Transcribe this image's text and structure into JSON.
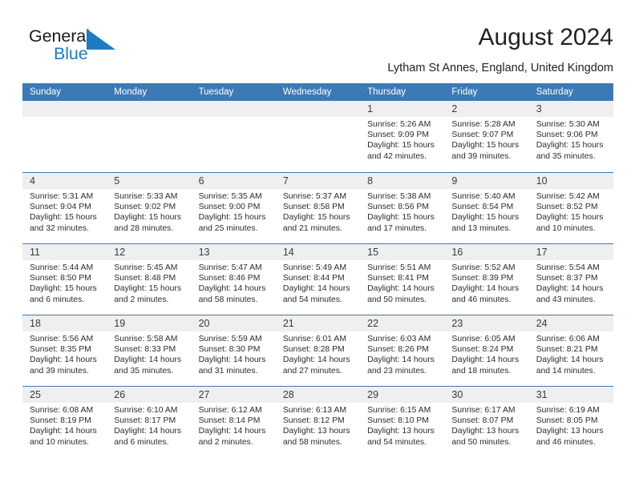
{
  "brand": {
    "name_part1": "General",
    "name_part2": "Blue",
    "logo_icon": "blue-triangle-flag-icon",
    "color_primary": "#1f7ac4",
    "color_text": "#1b1b1b"
  },
  "header": {
    "title": "August 2024",
    "subtitle": "Lytham St Annes, England, United Kingdom"
  },
  "theme": {
    "header_blue": "#3c7ab5",
    "date_strip_gray": "#efefef",
    "body_text": "#2c2c2c"
  },
  "calendar": {
    "weekdays": [
      "Sunday",
      "Monday",
      "Tuesday",
      "Wednesday",
      "Thursday",
      "Friday",
      "Saturday"
    ],
    "weeks": [
      [
        {
          "day": "",
          "empty": true
        },
        {
          "day": "",
          "empty": true
        },
        {
          "day": "",
          "empty": true
        },
        {
          "day": "",
          "empty": true
        },
        {
          "day": "1",
          "sunrise": "Sunrise: 5:26 AM",
          "sunset": "Sunset: 9:09 PM",
          "daylight1": "Daylight: 15 hours",
          "daylight2": "and 42 minutes."
        },
        {
          "day": "2",
          "sunrise": "Sunrise: 5:28 AM",
          "sunset": "Sunset: 9:07 PM",
          "daylight1": "Daylight: 15 hours",
          "daylight2": "and 39 minutes."
        },
        {
          "day": "3",
          "sunrise": "Sunrise: 5:30 AM",
          "sunset": "Sunset: 9:06 PM",
          "daylight1": "Daylight: 15 hours",
          "daylight2": "and 35 minutes."
        }
      ],
      [
        {
          "day": "4",
          "sunrise": "Sunrise: 5:31 AM",
          "sunset": "Sunset: 9:04 PM",
          "daylight1": "Daylight: 15 hours",
          "daylight2": "and 32 minutes."
        },
        {
          "day": "5",
          "sunrise": "Sunrise: 5:33 AM",
          "sunset": "Sunset: 9:02 PM",
          "daylight1": "Daylight: 15 hours",
          "daylight2": "and 28 minutes."
        },
        {
          "day": "6",
          "sunrise": "Sunrise: 5:35 AM",
          "sunset": "Sunset: 9:00 PM",
          "daylight1": "Daylight: 15 hours",
          "daylight2": "and 25 minutes."
        },
        {
          "day": "7",
          "sunrise": "Sunrise: 5:37 AM",
          "sunset": "Sunset: 8:58 PM",
          "daylight1": "Daylight: 15 hours",
          "daylight2": "and 21 minutes."
        },
        {
          "day": "8",
          "sunrise": "Sunrise: 5:38 AM",
          "sunset": "Sunset: 8:56 PM",
          "daylight1": "Daylight: 15 hours",
          "daylight2": "and 17 minutes."
        },
        {
          "day": "9",
          "sunrise": "Sunrise: 5:40 AM",
          "sunset": "Sunset: 8:54 PM",
          "daylight1": "Daylight: 15 hours",
          "daylight2": "and 13 minutes."
        },
        {
          "day": "10",
          "sunrise": "Sunrise: 5:42 AM",
          "sunset": "Sunset: 8:52 PM",
          "daylight1": "Daylight: 15 hours",
          "daylight2": "and 10 minutes."
        }
      ],
      [
        {
          "day": "11",
          "sunrise": "Sunrise: 5:44 AM",
          "sunset": "Sunset: 8:50 PM",
          "daylight1": "Daylight: 15 hours",
          "daylight2": "and 6 minutes."
        },
        {
          "day": "12",
          "sunrise": "Sunrise: 5:45 AM",
          "sunset": "Sunset: 8:48 PM",
          "daylight1": "Daylight: 15 hours",
          "daylight2": "and 2 minutes."
        },
        {
          "day": "13",
          "sunrise": "Sunrise: 5:47 AM",
          "sunset": "Sunset: 8:46 PM",
          "daylight1": "Daylight: 14 hours",
          "daylight2": "and 58 minutes."
        },
        {
          "day": "14",
          "sunrise": "Sunrise: 5:49 AM",
          "sunset": "Sunset: 8:44 PM",
          "daylight1": "Daylight: 14 hours",
          "daylight2": "and 54 minutes."
        },
        {
          "day": "15",
          "sunrise": "Sunrise: 5:51 AM",
          "sunset": "Sunset: 8:41 PM",
          "daylight1": "Daylight: 14 hours",
          "daylight2": "and 50 minutes."
        },
        {
          "day": "16",
          "sunrise": "Sunrise: 5:52 AM",
          "sunset": "Sunset: 8:39 PM",
          "daylight1": "Daylight: 14 hours",
          "daylight2": "and 46 minutes."
        },
        {
          "day": "17",
          "sunrise": "Sunrise: 5:54 AM",
          "sunset": "Sunset: 8:37 PM",
          "daylight1": "Daylight: 14 hours",
          "daylight2": "and 43 minutes."
        }
      ],
      [
        {
          "day": "18",
          "sunrise": "Sunrise: 5:56 AM",
          "sunset": "Sunset: 8:35 PM",
          "daylight1": "Daylight: 14 hours",
          "daylight2": "and 39 minutes."
        },
        {
          "day": "19",
          "sunrise": "Sunrise: 5:58 AM",
          "sunset": "Sunset: 8:33 PM",
          "daylight1": "Daylight: 14 hours",
          "daylight2": "and 35 minutes."
        },
        {
          "day": "20",
          "sunrise": "Sunrise: 5:59 AM",
          "sunset": "Sunset: 8:30 PM",
          "daylight1": "Daylight: 14 hours",
          "daylight2": "and 31 minutes."
        },
        {
          "day": "21",
          "sunrise": "Sunrise: 6:01 AM",
          "sunset": "Sunset: 8:28 PM",
          "daylight1": "Daylight: 14 hours",
          "daylight2": "and 27 minutes."
        },
        {
          "day": "22",
          "sunrise": "Sunrise: 6:03 AM",
          "sunset": "Sunset: 8:26 PM",
          "daylight1": "Daylight: 14 hours",
          "daylight2": "and 23 minutes."
        },
        {
          "day": "23",
          "sunrise": "Sunrise: 6:05 AM",
          "sunset": "Sunset: 8:24 PM",
          "daylight1": "Daylight: 14 hours",
          "daylight2": "and 18 minutes."
        },
        {
          "day": "24",
          "sunrise": "Sunrise: 6:06 AM",
          "sunset": "Sunset: 8:21 PM",
          "daylight1": "Daylight: 14 hours",
          "daylight2": "and 14 minutes."
        }
      ],
      [
        {
          "day": "25",
          "sunrise": "Sunrise: 6:08 AM",
          "sunset": "Sunset: 8:19 PM",
          "daylight1": "Daylight: 14 hours",
          "daylight2": "and 10 minutes."
        },
        {
          "day": "26",
          "sunrise": "Sunrise: 6:10 AM",
          "sunset": "Sunset: 8:17 PM",
          "daylight1": "Daylight: 14 hours",
          "daylight2": "and 6 minutes."
        },
        {
          "day": "27",
          "sunrise": "Sunrise: 6:12 AM",
          "sunset": "Sunset: 8:14 PM",
          "daylight1": "Daylight: 14 hours",
          "daylight2": "and 2 minutes."
        },
        {
          "day": "28",
          "sunrise": "Sunrise: 6:13 AM",
          "sunset": "Sunset: 8:12 PM",
          "daylight1": "Daylight: 13 hours",
          "daylight2": "and 58 minutes."
        },
        {
          "day": "29",
          "sunrise": "Sunrise: 6:15 AM",
          "sunset": "Sunset: 8:10 PM",
          "daylight1": "Daylight: 13 hours",
          "daylight2": "and 54 minutes."
        },
        {
          "day": "30",
          "sunrise": "Sunrise: 6:17 AM",
          "sunset": "Sunset: 8:07 PM",
          "daylight1": "Daylight: 13 hours",
          "daylight2": "and 50 minutes."
        },
        {
          "day": "31",
          "sunrise": "Sunrise: 6:19 AM",
          "sunset": "Sunset: 8:05 PM",
          "daylight1": "Daylight: 13 hours",
          "daylight2": "and 46 minutes."
        }
      ]
    ]
  }
}
